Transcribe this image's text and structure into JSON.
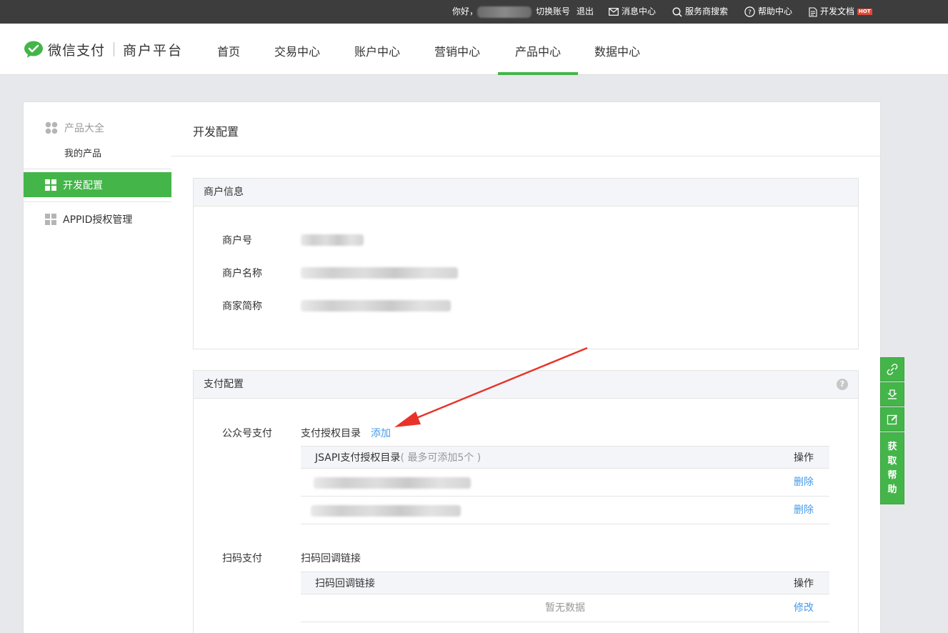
{
  "topbar": {
    "greeting": "你好，",
    "switch_account": "切换账号",
    "logout": "退出",
    "messages": "消息中心",
    "service_search": "服务商搜索",
    "help_center": "帮助中心",
    "dev_docs": "开发文档",
    "hot_badge": "HOT",
    "icons": [
      "mail-icon",
      "search-icon",
      "question-icon",
      "document-icon"
    ]
  },
  "header": {
    "brand": "微信支付",
    "platform": "商户平台",
    "nav": [
      "首页",
      "交易中心",
      "账户中心",
      "营销中心",
      "产品中心",
      "数据中心"
    ],
    "active_nav": "产品中心",
    "accent_color": "#44b549"
  },
  "sidebar": {
    "group_title": "产品大全",
    "items": [
      "我的产品",
      "开发配置",
      "APPID授权管理"
    ],
    "active_item": "开发配置"
  },
  "page": {
    "title": "开发配置"
  },
  "merchant_info": {
    "heading": "商户信息",
    "fields": [
      "商户号",
      "商户名称",
      "商家简称"
    ]
  },
  "pay_config": {
    "heading": "支付配置",
    "help_glyph": "?",
    "jsapi": {
      "section_label": "公众号支付",
      "sub_label": "支付授权目录",
      "add_link": "添加",
      "table_header": "JSAPI支付授权目录",
      "table_hint": "( 最多可添加5个 )",
      "action_header": "操作",
      "row_actions": [
        "删除",
        "删除"
      ]
    },
    "native": {
      "section_label": "扫码支付",
      "sub_label": "扫码回调链接",
      "table_header": "扫码回调链接",
      "action_header": "操作",
      "empty_text": "暂无数据",
      "edit_link": "修改"
    }
  },
  "float_tools": {
    "icons": [
      "link-icon",
      "download-icon",
      "edit-icon"
    ],
    "help_label": [
      "获",
      "取",
      "帮",
      "助"
    ]
  }
}
